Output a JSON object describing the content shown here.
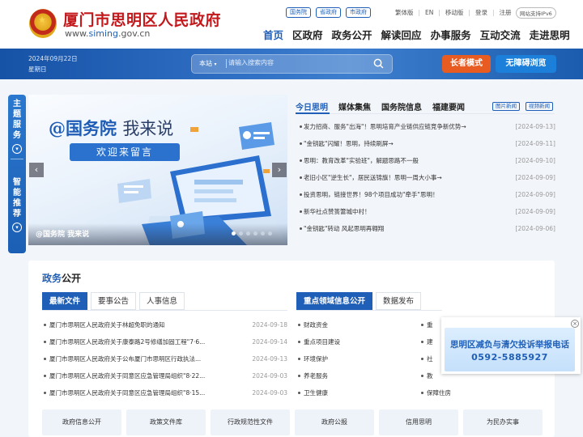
{
  "header": {
    "title": "厦门市思明区人民政府",
    "domain_prefix": "www.",
    "domain_main": "siming",
    "domain_suffix": ".gov.cn",
    "links": [
      "国务院",
      "省政府",
      "市政府"
    ],
    "utility": [
      "繁体版",
      "EN",
      "移动版",
      "登录",
      "注册"
    ],
    "ipv6": "网站支持IPv6"
  },
  "nav": [
    "首页",
    "区政府",
    "政务公开",
    "解读回应",
    "办事服务",
    "互动交流",
    "走进思明"
  ],
  "banner": {
    "date": "2024年09月22日",
    "weekday": "星期日",
    "search_scope": "本站",
    "search_placeholder": "请输入搜索内容",
    "elder_mode": "长者模式",
    "accessible": "无障碍浏览"
  },
  "sidebar": {
    "topic": [
      "主",
      "题",
      "服",
      "务"
    ],
    "smart": [
      "智",
      "能",
      "推",
      "荐"
    ]
  },
  "slider": {
    "headline_at": "@国务院",
    "headline_rest": "我来说",
    "subtitle": "欢迎来留言",
    "caption": "@国务院 我来说"
  },
  "news": {
    "tabs": [
      "今日思明",
      "媒体集焦",
      "国务院信息",
      "福建要闻"
    ],
    "tags": [
      "图片新闻",
      "视频新闻"
    ],
    "items": [
      {
        "title": "发力招商、服务\"出海\"！思明培育产业链供应链竞争新优势→",
        "date": "[2024-09-13]"
      },
      {
        "title": "\"金钥匙\"闪耀！思明，持续刷屏→",
        "date": "[2024-09-11]"
      },
      {
        "title": "思明：教育改革\"实验班\"，解题思路不一般",
        "date": "[2024-09-10]"
      },
      {
        "title": "老旧小区\"逆生长\"，居民送锦旗！思明一周大小事→",
        "date": "[2024-09-09]"
      },
      {
        "title": "投资思明，链接世界！98个项目成功\"牵手\"思明！",
        "date": "[2024-09-09]"
      },
      {
        "title": "新华社点赞篑簹城中村！",
        "date": "[2024-09-09]"
      },
      {
        "title": "\"金钥匙\"转动 风起思明再翱翔",
        "date": "[2024-09-06]"
      }
    ]
  },
  "gov": {
    "title_a": "政务",
    "title_b": "公开",
    "left_tabs": [
      "最新文件",
      "要事公告",
      "人事信息"
    ],
    "right_tabs": [
      "重点领域信息公开",
      "数据发布"
    ],
    "files": [
      {
        "title": "厦门市思明区人民政府关于林超免职的通知",
        "date": "2024-09-18"
      },
      {
        "title": "厦门市思明区人民政府关于康泰路2号修缮加固工程\"7·6...",
        "date": "2024-09-14"
      },
      {
        "title": "厦门市思明区人民政府关于公布厦门市思明区行政执法...",
        "date": "2024-09-13"
      },
      {
        "title": "厦门市思明区人民政府关于同意区应急管理局组织\"8·22...",
        "date": "2024-09-03"
      },
      {
        "title": "厦门市思明区人民政府关于同意区应急管理局组织\"8·15...",
        "date": "2024-09-03"
      }
    ],
    "areas_col1": [
      "财政资金",
      "重点项目建设",
      "环境保护",
      "养老服务",
      "卫生健康"
    ],
    "areas_col2": [
      "重",
      "建",
      "社",
      "教",
      "保障住房"
    ],
    "quick_links": [
      "政府信息公开",
      "政策文件库",
      "行政规范性文件",
      "政府公报",
      "信用思明",
      "为民办实事"
    ]
  },
  "popup": {
    "line1": "思明区减负与清欠投诉举报电话",
    "phone": "0592-5885927"
  }
}
